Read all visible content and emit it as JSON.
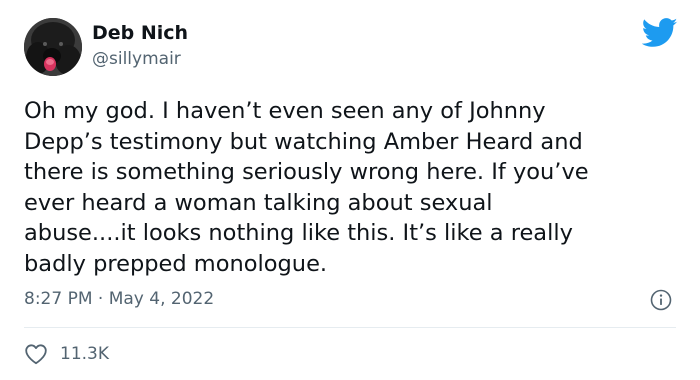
{
  "author": {
    "display_name": "Deb Nich",
    "handle": "@sillymair",
    "avatar_icon": "dog-avatar"
  },
  "brand": {
    "icon": "twitter-bird-icon",
    "color": "#1d9bf0"
  },
  "tweet": {
    "text": "Oh my god. I haven’t even seen any of Johnny\nDepp’s testimony but watching Amber Heard and\nthere is something seriously wrong here. If you’ve\never heard a woman talking about sexual\nabuse....it looks nothing like this. It’s like a really\nbadly prepped monologue.",
    "timestamp": "8:27 PM · May 4, 2022"
  },
  "engagement": {
    "likes": "11.3K",
    "like_icon": "heart-icon",
    "info_icon": "info-icon"
  },
  "colors": {
    "text_primary": "#0f1419",
    "text_secondary": "#536471",
    "divider": "#e6ecf0"
  }
}
